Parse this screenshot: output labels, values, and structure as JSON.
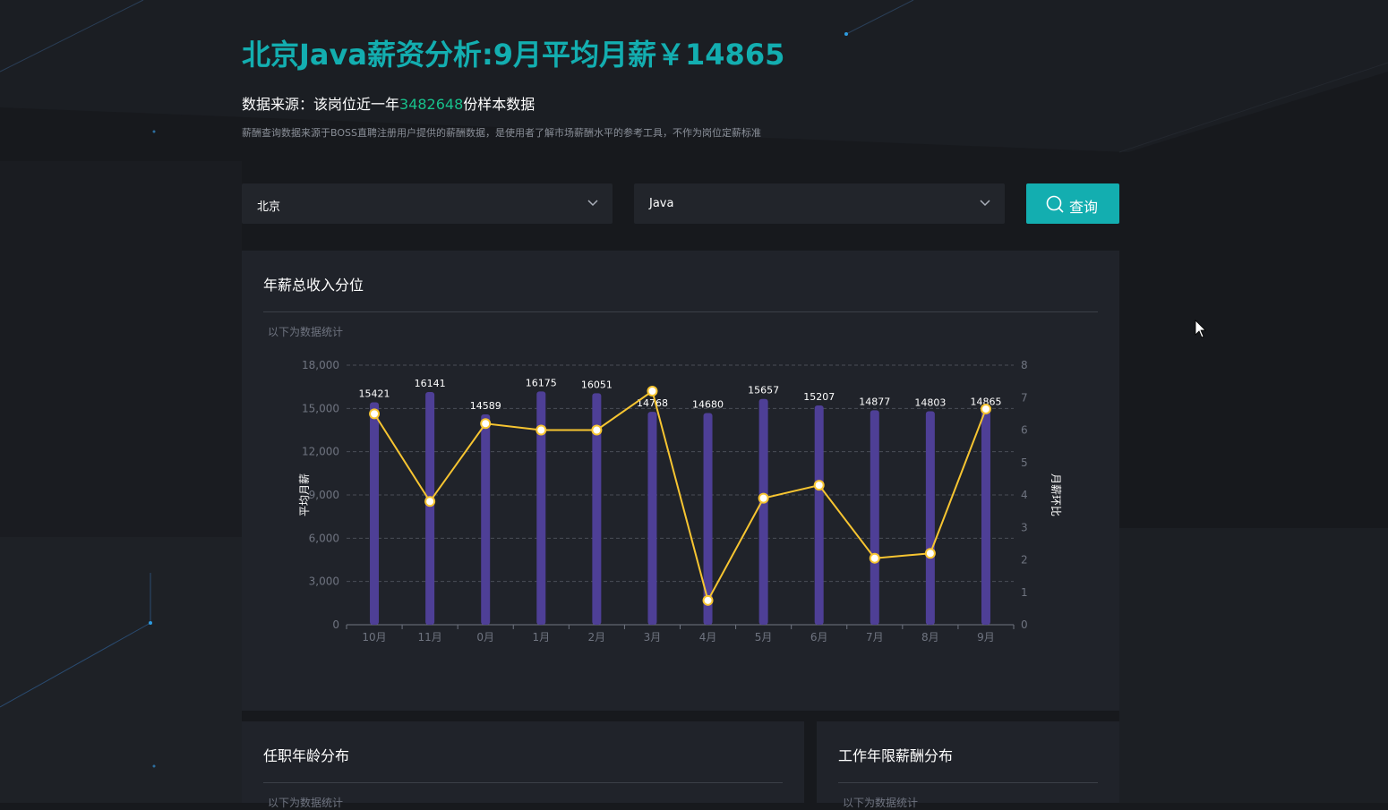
{
  "header": {
    "title": "北京Java薪资分析:9月平均月薪￥14865",
    "source_prefix": "数据来源：该岗位近一年",
    "sample_count": "3482648",
    "source_suffix": "份样本数据",
    "disclaimer": "薪酬查询数据来源于BOSS直聘注册用户提供的薪酬数据，是使用者了解市场薪酬水平的参考工具，不作为岗位定薪标准"
  },
  "filters": {
    "city": "北京",
    "job": "Java",
    "query_label": "查询"
  },
  "panels": {
    "main_title": "年薪总收入分位",
    "main_sub": "以下为数据统计",
    "age_title": "任职年龄分布",
    "age_sub": "以下为数据统计",
    "years_title": "工作年限薪酬分布",
    "years_sub": "以下为数据统计"
  },
  "colors": {
    "accent": "#13aeb0",
    "sample_count": "#17c08b",
    "bar": "#4e3f96",
    "line": "#f7c531"
  },
  "chart_data": {
    "type": "bar",
    "categories": [
      "10月",
      "11月",
      "0月",
      "1月",
      "2月",
      "3月",
      "4月",
      "5月",
      "6月",
      "7月",
      "8月",
      "9月"
    ],
    "series": [
      {
        "type": "bar",
        "axis": "left",
        "values": [
          15421,
          16141,
          14589,
          16175,
          16051,
          14768,
          14680,
          15657,
          15207,
          14877,
          14803,
          14865
        ]
      },
      {
        "type": "line",
        "axis": "right",
        "values": [
          6.5,
          3.8,
          6.2,
          6.0,
          6.0,
          7.2,
          0.75,
          3.9,
          4.3,
          2.05,
          2.2,
          6.65
        ]
      }
    ],
    "ylabel": "平均月薪",
    "y2label": "月薪环比",
    "ylim": [
      0,
      18000
    ],
    "y_ticks": [
      "0",
      "3,000",
      "6,000",
      "9,000",
      "12,000",
      "15,000",
      "18,000"
    ],
    "y2lim": [
      0,
      8
    ],
    "y2_ticks": [
      "0",
      "1",
      "2",
      "3",
      "4",
      "5",
      "6",
      "7",
      "8"
    ],
    "grid": true
  }
}
